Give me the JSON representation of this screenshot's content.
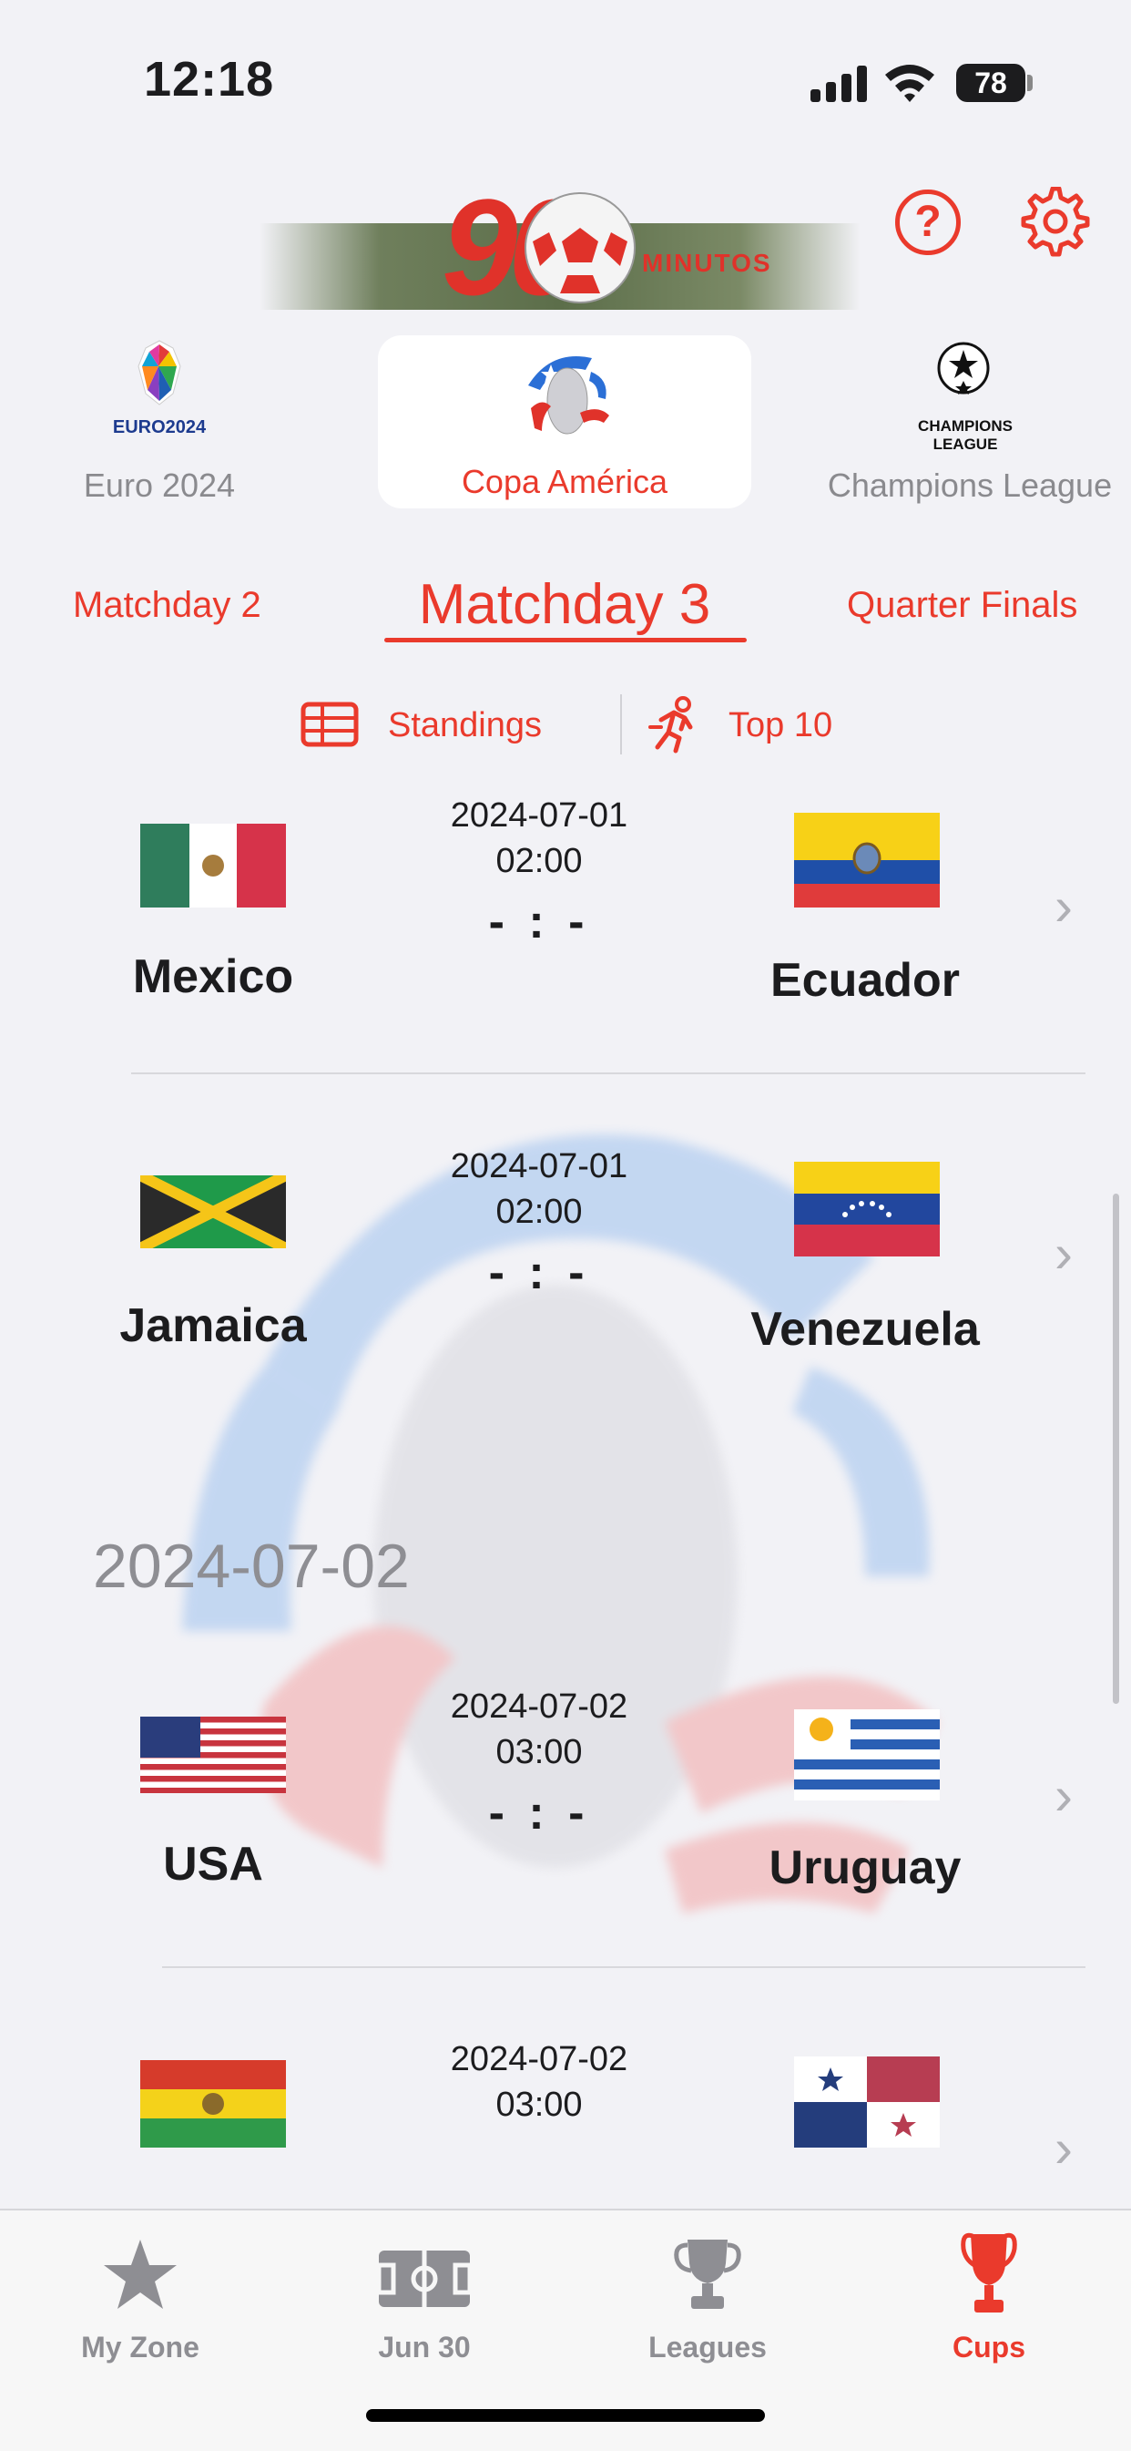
{
  "status": {
    "time": "12:18",
    "battery": "78"
  },
  "header": {
    "logo_digits": "90",
    "logo_word": "MINUTOS"
  },
  "cups": [
    {
      "label": "Euro 2024",
      "logo_text": "EURO2024"
    },
    {
      "label": "Copa América"
    },
    {
      "label": "Champions League",
      "logo_text": "CHAMPIONS LEAGUE"
    }
  ],
  "matchdays": {
    "prev": "Matchday  2",
    "current": "Matchday  3",
    "next": "Quarter Finals"
  },
  "links": {
    "standings": "Standings",
    "top10": "Top 10"
  },
  "section_date": "2024-07-02",
  "matches": [
    {
      "home": "Mexico",
      "away": "Ecuador",
      "date": "2024-07-01",
      "time": "02:00",
      "score": "- : -"
    },
    {
      "home": "Jamaica",
      "away": "Venezuela",
      "date": "2024-07-01",
      "time": "02:00",
      "score": "- : -"
    },
    {
      "home": "USA",
      "away": "Uruguay",
      "date": "2024-07-02",
      "time": "03:00",
      "score": "- : -"
    },
    {
      "home": "",
      "away": "",
      "date": "2024-07-02",
      "time": "03:00",
      "score": ""
    }
  ],
  "tabs": [
    {
      "label": "My Zone",
      "icon": "star-icon"
    },
    {
      "label": "Jun 30",
      "icon": "pitch-icon"
    },
    {
      "label": "Leagues",
      "icon": "trophy-icon"
    },
    {
      "label": "Cups",
      "icon": "cup-icon",
      "active": true
    }
  ],
  "colors": {
    "accent": "#ea3a2c",
    "background": "#f2f2f6"
  }
}
